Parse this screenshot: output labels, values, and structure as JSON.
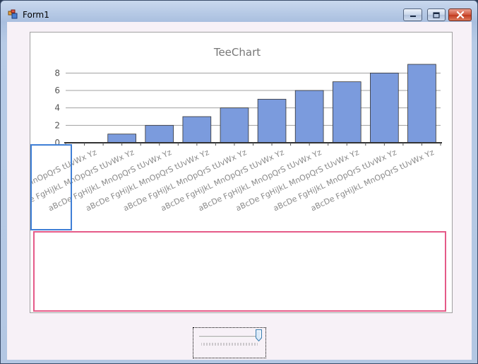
{
  "window": {
    "title": "Form1"
  },
  "colors": {
    "bar_fill": "#7b9bdd",
    "bar_stroke": "#333333",
    "title_color": "#777777",
    "label_color": "#8a8a8a",
    "highlight_blue": "#3f7fd6",
    "highlight_pink": "#e55a88"
  },
  "icons": {
    "app": "form-app-icon",
    "minimize": "minimize-icon",
    "maximize": "maximize-icon",
    "close": "close-icon"
  },
  "trackbar": {
    "value_fraction": 1.0
  },
  "chart_data": {
    "type": "bar",
    "title": "TeeChart",
    "categories": [
      "aBcDe FgHiJkL MnOpQrS tUvWx Yz",
      "aBcDe FgHiJkL MnOpQrS tUvWx Yz",
      "aBcDe FgHiJkL MnOpQrS tUvWx Yz",
      "aBcDe FgHiJkL MnOpQrS tUvWx Yz",
      "aBcDe FgHiJkL MnOpQrS tUvWx Yz",
      "aBcDe FgHiJkL MnOpQrS tUvWx Yz",
      "aBcDe FgHiJkL MnOpQrS tUvWx Yz",
      "aBcDe FgHiJkL MnOpQrS tUvWx Yz",
      "aBcDe FgHiJkL MnOpQrS tUvWx Yz",
      "aBcDe FgHiJkL MnOpQrS tUvWx Yz"
    ],
    "values": [
      0,
      1,
      2,
      3,
      4,
      5,
      6,
      7,
      8,
      9
    ],
    "yticks": [
      "0",
      "2",
      "4",
      "6",
      "8"
    ],
    "ytick_values": [
      0,
      2,
      4,
      6,
      8
    ],
    "ylim": [
      0,
      9
    ],
    "grid": true,
    "xlabel": "",
    "ylabel": ""
  }
}
